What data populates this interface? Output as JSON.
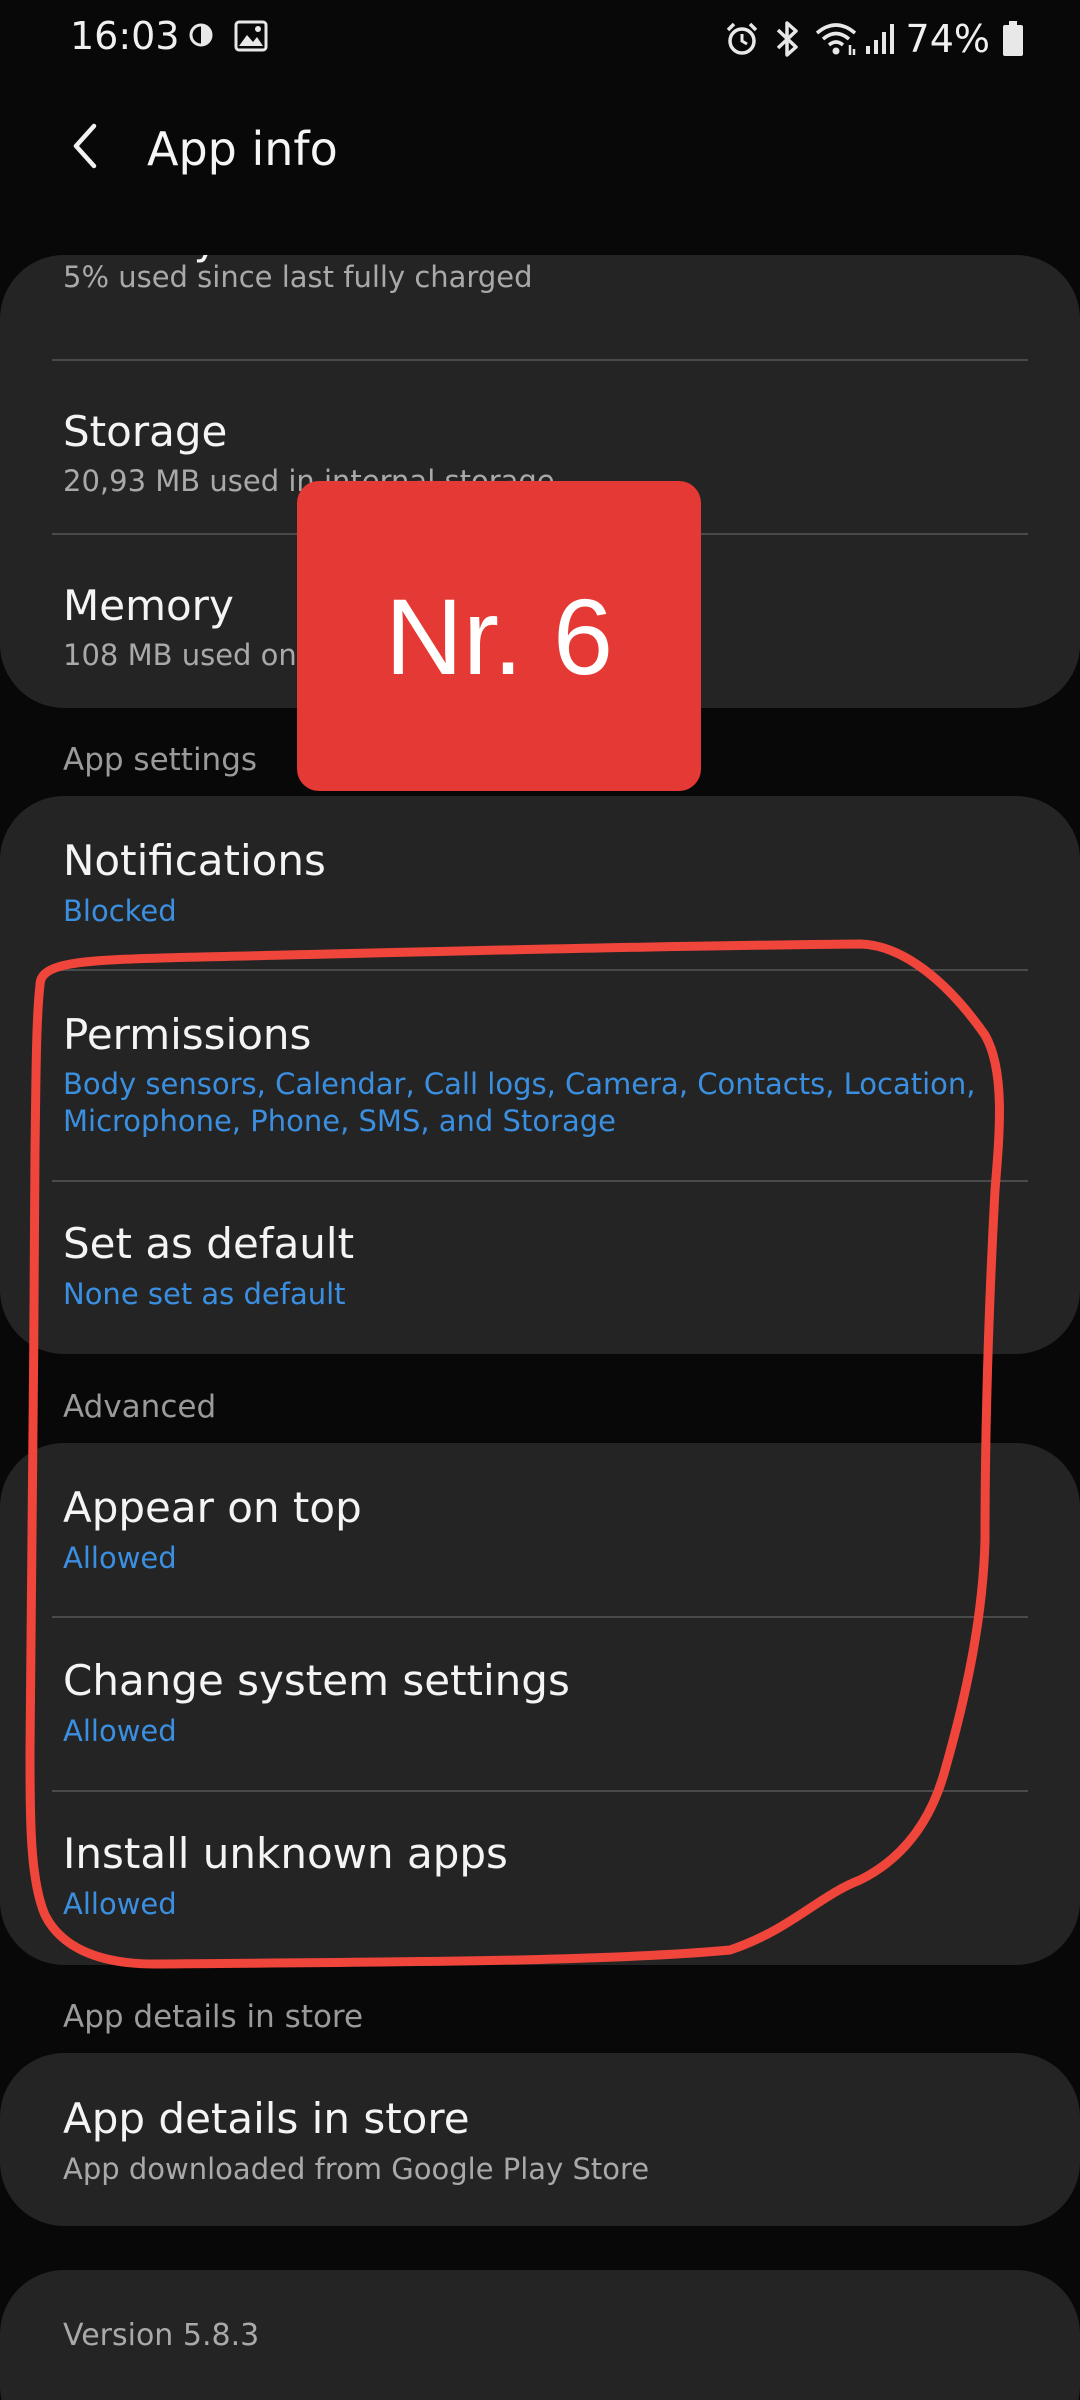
{
  "status_bar": {
    "time": "16:03",
    "battery_percent": "74%",
    "left_icons": [
      "brightness-half-icon",
      "image-icon"
    ],
    "right_icons": [
      "alarm-icon",
      "bluetooth-icon",
      "wifi-icon",
      "signal-icon",
      "battery-icon"
    ]
  },
  "header": {
    "title": "App info"
  },
  "usage_card": {
    "battery": {
      "title": "Battery",
      "subtitle": "5% used since last fully charged"
    },
    "storage": {
      "title": "Storage",
      "subtitle": "20,93 MB used in internal storage"
    },
    "memory": {
      "title": "Memory",
      "subtitle": "108 MB used on average in last 3 hours"
    }
  },
  "badge": {
    "label": "Nr. 6"
  },
  "sections": {
    "app_settings": "App settings",
    "advanced": "Advanced",
    "store": "App details in store"
  },
  "app_settings": {
    "notifications": {
      "title": "Notifications",
      "subtitle": "Blocked"
    },
    "permissions": {
      "title": "Permissions",
      "subtitle_line1": "Body sensors, Calendar, Call logs, Camera, Contacts, Location,",
      "subtitle_line2": "Microphone, Phone, SMS, and Storage"
    },
    "default": {
      "title": "Set as default",
      "subtitle": "None set as default"
    }
  },
  "advanced": {
    "appear_on_top": {
      "title": "Appear on top",
      "subtitle": "Allowed"
    },
    "change_system": {
      "title": "Change system settings",
      "subtitle": "Allowed"
    },
    "unknown_apps": {
      "title": "Install unknown apps",
      "subtitle": "Allowed"
    }
  },
  "store": {
    "details": {
      "title": "App details in store",
      "subtitle": "App downloaded from Google Play Store"
    }
  },
  "version": "Version 5.8.3",
  "colors": {
    "background": "#080808",
    "card": "#242424",
    "accent_blue": "#3b8fe0",
    "badge_red": "#e53935",
    "annotation_red": "#f0453a"
  }
}
